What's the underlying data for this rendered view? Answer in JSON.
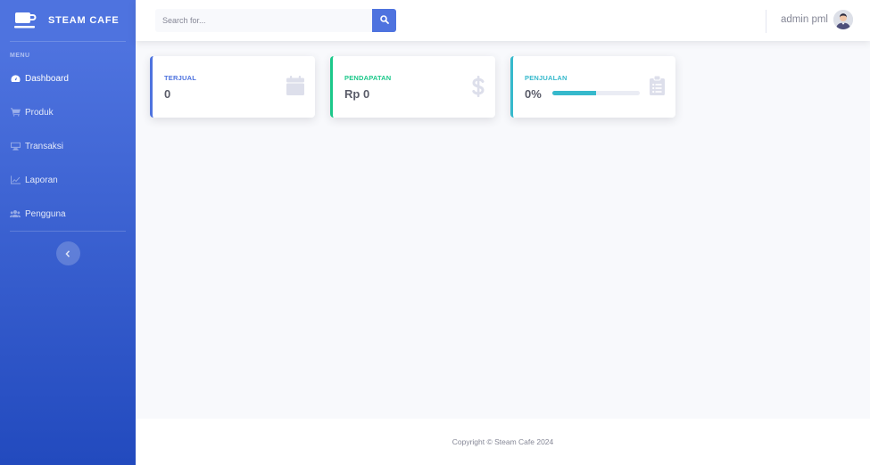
{
  "brand": {
    "name": "STEAM CAFE",
    "icon": "coffee-cup-icon"
  },
  "sidebar": {
    "heading": "MENU",
    "items": [
      {
        "label": "Dashboard",
        "icon": "tachometer-icon",
        "active": true
      },
      {
        "label": "Produk",
        "icon": "shopping-cart-icon",
        "active": false
      },
      {
        "label": "Transaksi",
        "icon": "desktop-icon",
        "active": false
      },
      {
        "label": "Laporan",
        "icon": "chart-line-icon",
        "active": false
      },
      {
        "label": "Pengguna",
        "icon": "users-icon",
        "active": false
      }
    ],
    "toggle_icon": "chevron-left-icon"
  },
  "topbar": {
    "search_placeholder": "Search for...",
    "search_icon": "search-icon",
    "user_name": "admin pml"
  },
  "cards": {
    "terjual": {
      "label": "TERJUAL",
      "value": "0",
      "icon": "calendar-icon",
      "color": "#4e73df"
    },
    "pendapatan": {
      "label": "PENDAPATAN",
      "value": "Rp 0",
      "icon": "dollar-icon",
      "color": "#1cc88a"
    },
    "penjualan": {
      "label": "PENJUALAN",
      "value": "0%",
      "progress": 0.5,
      "icon": "clipboard-list-icon",
      "color": "#36b9cc"
    }
  },
  "footer": {
    "copyright": "Copyright © Steam Cafe 2024"
  },
  "colors": {
    "primary": "#4e73df",
    "success": "#1cc88a",
    "info": "#36b9cc",
    "text_muted": "#858796"
  }
}
